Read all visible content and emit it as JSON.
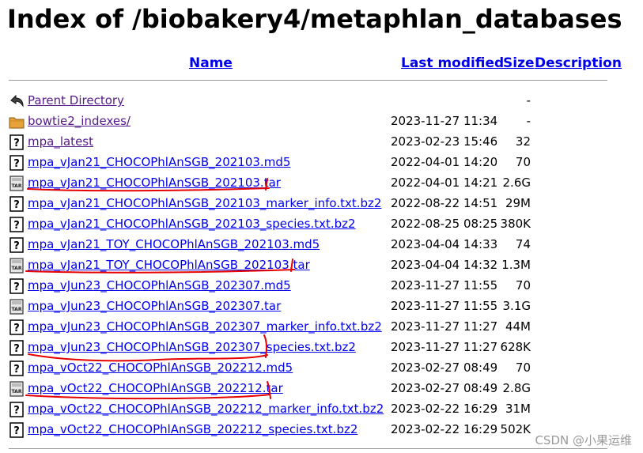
{
  "page": {
    "title": "Index of /biobakery4/metaphlan_databases"
  },
  "columns": {
    "name": "Name",
    "last_modified": "Last modified",
    "size": "Size",
    "description": "Description"
  },
  "rows": [
    {
      "icon": "back-icon",
      "name": "Parent Directory",
      "date": "",
      "size": "-",
      "visited": true
    },
    {
      "icon": "folder-icon",
      "name": "bowtie2_indexes/",
      "date": "2023-11-27 11:34",
      "size": "-",
      "visited": true
    },
    {
      "icon": "unknown-file-icon",
      "name": "mpa_latest",
      "date": "2023-02-23 15:46",
      "size": "32",
      "visited": true
    },
    {
      "icon": "unknown-file-icon",
      "name": "mpa_vJan21_CHOCOPhlAnSGB_202103.md5",
      "date": "2022-04-01 14:20",
      "size": "70",
      "visited": false
    },
    {
      "icon": "tar-file-icon",
      "name": "mpa_vJan21_CHOCOPhlAnSGB_202103.tar",
      "date": "2022-04-01 14:21",
      "size": "2.6G",
      "visited": false
    },
    {
      "icon": "unknown-file-icon",
      "name": "mpa_vJan21_CHOCOPhlAnSGB_202103_marker_info.txt.bz2",
      "date": "2022-08-22 14:51",
      "size": "29M",
      "visited": false
    },
    {
      "icon": "unknown-file-icon",
      "name": "mpa_vJan21_CHOCOPhlAnSGB_202103_species.txt.bz2",
      "date": "2022-08-25 08:25",
      "size": "380K",
      "visited": false
    },
    {
      "icon": "unknown-file-icon",
      "name": "mpa_vJan21_TOY_CHOCOPhlAnSGB_202103.md5",
      "date": "2023-04-04 14:33",
      "size": "74",
      "visited": false
    },
    {
      "icon": "tar-file-icon",
      "name": "mpa_vJan21_TOY_CHOCOPhlAnSGB_202103.tar",
      "date": "2023-04-04 14:32",
      "size": "1.3M",
      "visited": false
    },
    {
      "icon": "unknown-file-icon",
      "name": "mpa_vJun23_CHOCOPhlAnSGB_202307.md5",
      "date": "2023-11-27 11:55",
      "size": "70",
      "visited": false
    },
    {
      "icon": "tar-file-icon",
      "name": "mpa_vJun23_CHOCOPhlAnSGB_202307.tar",
      "date": "2023-11-27 11:55",
      "size": "3.1G",
      "visited": false
    },
    {
      "icon": "unknown-file-icon",
      "name": "mpa_vJun23_CHOCOPhlAnSGB_202307_marker_info.txt.bz2",
      "date": "2023-11-27 11:27",
      "size": "44M",
      "visited": false
    },
    {
      "icon": "unknown-file-icon",
      "name": "mpa_vJun23_CHOCOPhlAnSGB_202307_species.txt.bz2",
      "date": "2023-11-27 11:27",
      "size": "628K",
      "visited": false
    },
    {
      "icon": "unknown-file-icon",
      "name": "mpa_vOct22_CHOCOPhlAnSGB_202212.md5",
      "date": "2023-02-27 08:49",
      "size": "70",
      "visited": false
    },
    {
      "icon": "tar-file-icon",
      "name": "mpa_vOct22_CHOCOPhlAnSGB_202212.tar",
      "date": "2023-02-27 08:49",
      "size": "2.8G",
      "visited": false
    },
    {
      "icon": "unknown-file-icon",
      "name": "mpa_vOct22_CHOCOPhlAnSGB_202212_marker_info.txt.bz2",
      "date": "2023-02-22 16:29",
      "size": "31M",
      "visited": false
    },
    {
      "icon": "unknown-file-icon",
      "name": "mpa_vOct22_CHOCOPhlAnSGB_202212_species.txt.bz2",
      "date": "2023-02-22 16:29",
      "size": "502K",
      "visited": false
    }
  ],
  "watermark": "CSDN @小果运维",
  "colors": {
    "link": "#0000ee",
    "visited_link": "#551a8b",
    "annotation": "#e60000"
  }
}
